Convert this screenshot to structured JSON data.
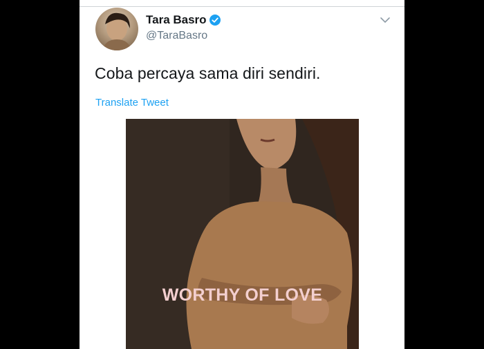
{
  "tweet": {
    "author_name": "Tara Basro",
    "handle": "@TaraBasro",
    "text": "Coba percaya sama diri sendiri.",
    "translate_label": "Translate Tweet",
    "verified": true
  },
  "media": {
    "overlay_text": "WORTHY OF LOVE"
  },
  "icons": {
    "verified": "verified-badge-icon",
    "menu": "chevron-down-icon"
  },
  "colors": {
    "link": "#1da1f2",
    "name": "#14171a",
    "handle": "#657786",
    "overlay_text": "#f3cfcf"
  }
}
